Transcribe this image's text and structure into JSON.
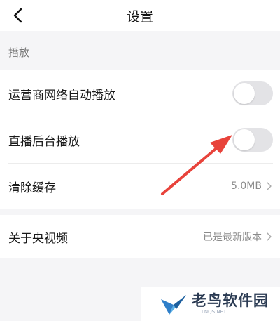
{
  "header": {
    "title": "设置"
  },
  "sections": {
    "playback_label": "播放"
  },
  "settings": {
    "carrier_autoplay": {
      "label": "运营商网络自动播放",
      "enabled": false
    },
    "live_background": {
      "label": "直播后台播放",
      "enabled": false
    },
    "clear_cache": {
      "label": "清除缓存",
      "value": "5.0MB"
    },
    "about": {
      "label": "关于央视频",
      "value": "已是最新版本"
    }
  },
  "annotation": {
    "arrow_color": "#e8433b",
    "target": "直播后台播放 toggle"
  },
  "watermark": {
    "name": "老鸟软件园",
    "domain": "LNQS.NET"
  },
  "colors": {
    "toggle_off": "#e3e3e6",
    "background": "#f5f5f7"
  }
}
